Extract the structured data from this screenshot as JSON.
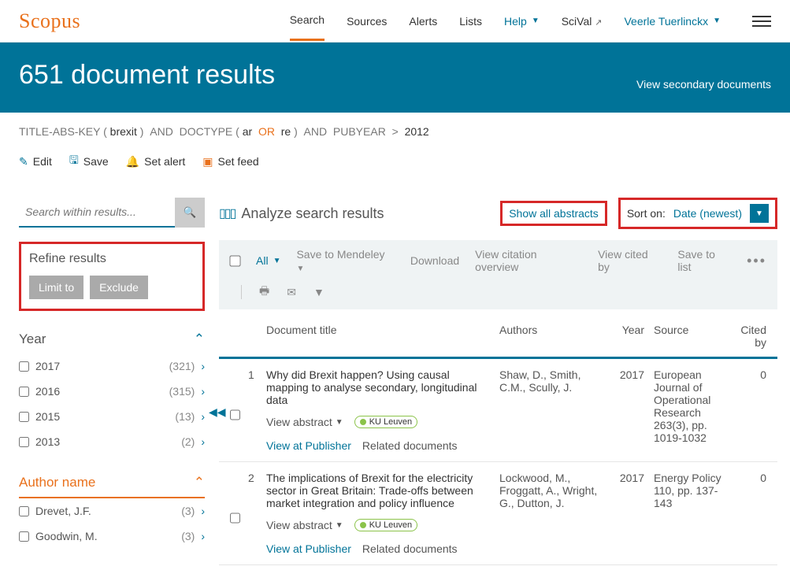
{
  "brand": "Scopus",
  "nav": {
    "search": "Search",
    "sources": "Sources",
    "alerts": "Alerts",
    "lists": "Lists",
    "help": "Help",
    "scival": "SciVal",
    "user": "Veerle Tuerlinckx"
  },
  "hero": {
    "title": "651 document results",
    "secondary": "View secondary documents"
  },
  "query": {
    "prefix": "TITLE-ABS-KEY",
    "term": "brexit",
    "and1": "AND",
    "doctype": "DOCTYPE",
    "ar": "ar",
    "or": "OR",
    "re": "re",
    "and2": "AND",
    "pubyear": "PUBYEAR",
    "gt": ">",
    "year": "2012"
  },
  "actions": {
    "edit": "Edit",
    "save": "Save",
    "alert": "Set alert",
    "feed": "Set feed"
  },
  "search_within": {
    "placeholder": "Search within results..."
  },
  "refine": {
    "title": "Refine results",
    "limit": "Limit to",
    "exclude": "Exclude"
  },
  "facet_year": {
    "title": "Year",
    "items": [
      {
        "label": "2017",
        "count": "(321)"
      },
      {
        "label": "2016",
        "count": "(315)"
      },
      {
        "label": "2015",
        "count": "(13)"
      },
      {
        "label": "2013",
        "count": "(2)"
      }
    ]
  },
  "facet_author": {
    "title": "Author name",
    "items": [
      {
        "label": "Drevet, J.F.",
        "count": "(3)"
      },
      {
        "label": "Goodwin, M.",
        "count": "(3)"
      }
    ]
  },
  "analyze": "Analyze search results",
  "show_abstracts": "Show all abstracts",
  "sort": {
    "label": "Sort on:",
    "value": "Date (newest)"
  },
  "toolbar": {
    "all": "All",
    "mendeley": "Save to Mendeley",
    "download": "Download",
    "citation": "View citation overview",
    "citedby": "View cited by",
    "savelist": "Save to list"
  },
  "columns": {
    "title": "Document title",
    "authors": "Authors",
    "year": "Year",
    "source": "Source",
    "cited": "Cited by"
  },
  "rows": [
    {
      "num": "1",
      "title": "Why did Brexit happen? Using causal mapping to analyse secondary, longitudinal data",
      "authors": "Shaw, D., Smith, C.M., Scully, J.",
      "year": "2017",
      "source": "European Journal of Operational Research 263(3), pp. 1019-1032",
      "cited": "0"
    },
    {
      "num": "2",
      "title": "The implications of Brexit for the electricity sector in Great Britain: Trade-offs between market integration and policy influence",
      "authors": "Lockwood, M., Froggatt, A., Wright, G., Dutton, J.",
      "year": "2017",
      "source": "Energy Policy 110, pp. 137-143",
      "cited": "0"
    }
  ],
  "row_actions": {
    "view_abstract": "View abstract",
    "ku": "KU Leuven",
    "publisher": "View at Publisher",
    "related": "Related documents"
  }
}
